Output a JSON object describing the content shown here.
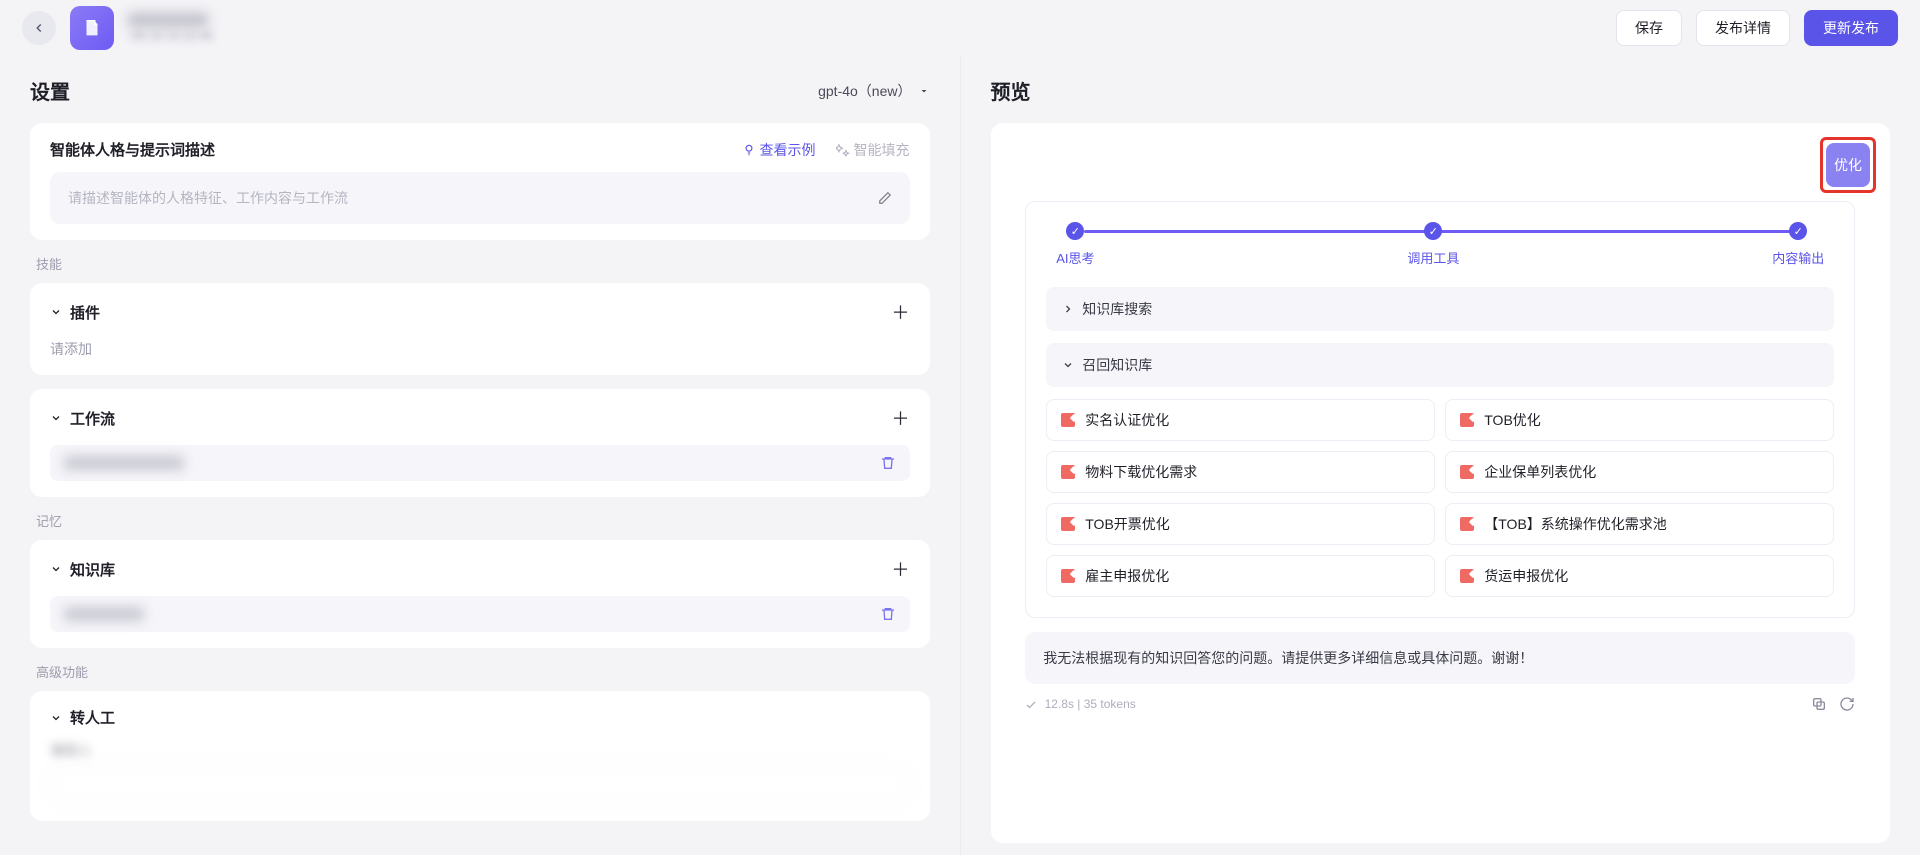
{
  "header": {
    "title": "",
    "subtitle": "            -06-16 15:10:46",
    "save": "保存",
    "publish_detail": "发布详情",
    "update_publish": "更新发布"
  },
  "left": {
    "title": "设置",
    "model": "gpt-4o（new）",
    "persona_title": "智能体人格与提示词描述",
    "view_example": "查看示例",
    "auto_fill": "智能填充",
    "persona_placeholder": "请描述智能体的人格特征、工作内容与工作流",
    "skill_label": "技能",
    "plugin_title": "插件",
    "plugin_empty": "请添加",
    "workflow_title": "工作流",
    "workflow_item": "",
    "memory_label": "记忆",
    "kb_title": "知识库",
    "kb_item": "",
    "advanced_label": "高级功能",
    "human_title": "转人工",
    "human_sub": "    联系人",
    "human_input": ""
  },
  "right": {
    "title": "预览",
    "opt_btn": "优化",
    "steps": [
      "AI思考",
      "调用工具",
      "内容输出"
    ],
    "kb_search": "知识库搜索",
    "kb_recall": "召回知识库",
    "kb_items_left": [
      "实名认证优化",
      "物料下载优化需求",
      "TOB开票优化",
      "雇主申报优化"
    ],
    "kb_items_right": [
      "TOB优化",
      "企业保单列表优化",
      "【TOB】系统操作优化需求池",
      "货运申报优化"
    ],
    "reply": "我无法根据现有的知识回答您的问题。请提供更多详细信息或具体问题。谢谢！",
    "meta": "12.8s  |  35 tokens"
  }
}
